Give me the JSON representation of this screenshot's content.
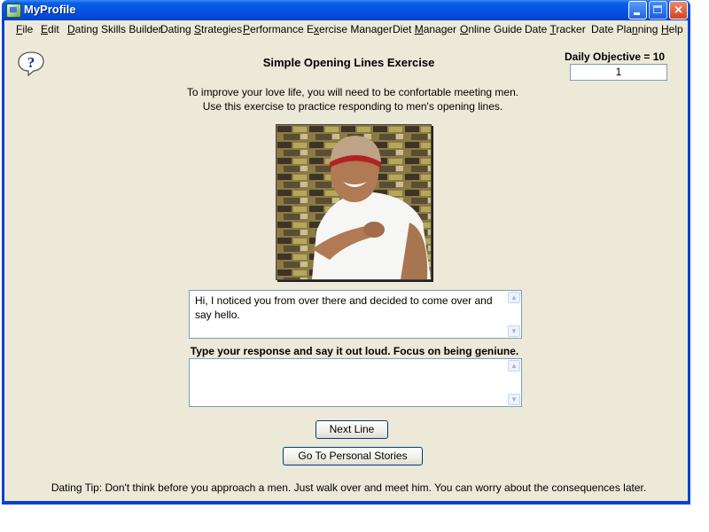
{
  "window": {
    "title": "MyProfile",
    "controls": {
      "minimize": "minimize-icon",
      "maximize": "maximize-icon",
      "close": "×"
    }
  },
  "menu": [
    {
      "label": "File",
      "mnemonic_index": 0
    },
    {
      "label": "Edit",
      "mnemonic_index": 0
    },
    {
      "label": "Dating Skills Builder",
      "mnemonic_index": 0
    },
    {
      "label": "Dating Strategies",
      "mnemonic_index": 7
    },
    {
      "label": "Performance",
      "mnemonic_index": 0
    },
    {
      "label": "Exercise Manager",
      "mnemonic_index": 1
    },
    {
      "label": "Diet Manager",
      "mnemonic_index": 5
    },
    {
      "label": "Online Guide",
      "mnemonic_index": 0
    },
    {
      "label": "Date Tracker",
      "mnemonic_index": 5
    },
    {
      "label": "Date Planning",
      "mnemonic_index": 8
    },
    {
      "label": "Help",
      "mnemonic_index": 0
    }
  ],
  "main": {
    "help_icon": "?",
    "title": "Simple Opening Lines Exercise",
    "daily_objective_label": "Daily Objective = 10",
    "daily_count": "1",
    "intro_line1": "To improve your love life, you will need to be confortable meeting men.",
    "intro_line2": "Use this exercise to practice responding to men's opening lines.",
    "photo_alt": "Smiling man in white t-shirt and knit cap pointing",
    "opening_line": "Hi, I noticed you from over there and decided to come over and say hello.",
    "response_label": "Type your response and say it out loud. Focus on being geniune.",
    "response_value": "",
    "next_button": "Next Line",
    "stories_button": "Go To Personal Stories",
    "tip": "Dating Tip: Don't think before you approach a men.  Just walk over and meet him. You can worry about the consequences later."
  }
}
